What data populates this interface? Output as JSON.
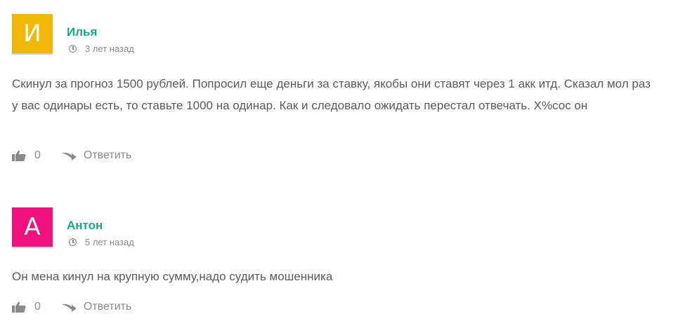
{
  "comments": [
    {
      "avatar_letter": "И",
      "avatar_color": "#f2b705",
      "author": "Илья",
      "time": "3 лет назад",
      "text": "Скинул за прогноз 1500 рублей. Попросил еще деньги за ставку, якобы они ставят через 1 акк итд. Сказал мол раз у вас одинары есть, то ставьте 1000 на одинар. Как и следовало ожидать перестал отвечать. Х%сос он",
      "likes": "0",
      "reply_label": "Ответить"
    },
    {
      "avatar_letter": "А",
      "avatar_color": "#f0107e",
      "author": "Антон",
      "time": "5 лет назад",
      "text": "Он мена кинул на крупную сумму,надо судить мошенника",
      "likes": "0",
      "reply_label": "Ответить"
    }
  ],
  "icons": {
    "clock": "clock-icon",
    "like": "thumbs-up-icon",
    "reply": "reply-arrow-icon"
  },
  "colors": {
    "author": "#16a97c",
    "meta": "#8a8a8a",
    "text": "#5a5a5a"
  }
}
